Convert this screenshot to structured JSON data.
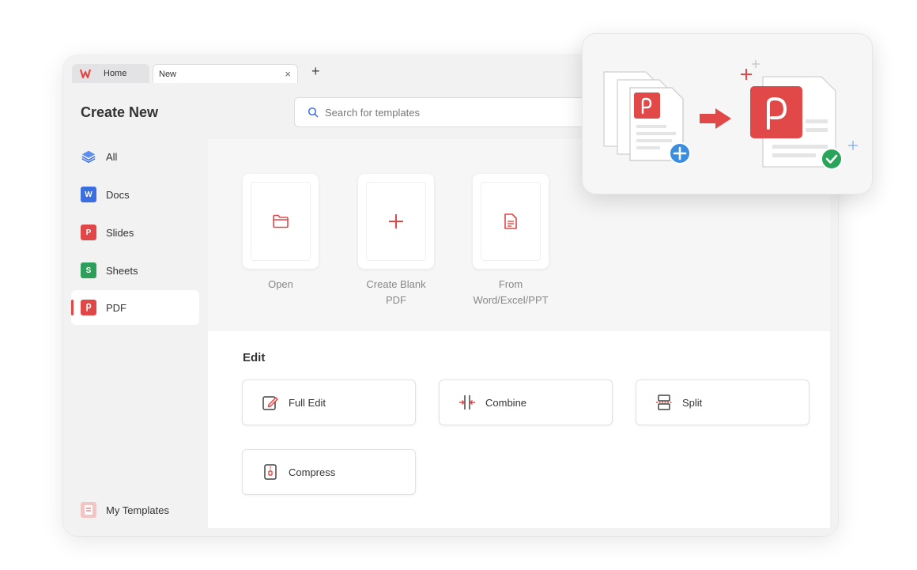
{
  "tabs": {
    "home_label": "Home",
    "new_label": "New",
    "close_glyph": "×",
    "add_glyph": "+"
  },
  "page": {
    "title": "Create New"
  },
  "search": {
    "placeholder": "Search for templates"
  },
  "sidebar": {
    "items": [
      {
        "label": "All",
        "icon": "all-stack-icon"
      },
      {
        "label": "Docs",
        "icon": "docs-icon",
        "badge": "W",
        "color": "#3b6fe0"
      },
      {
        "label": "Slides",
        "icon": "slides-icon",
        "badge": "P",
        "color": "#e04848"
      },
      {
        "label": "Sheets",
        "icon": "sheets-icon",
        "badge": "S",
        "color": "#2e9e5b"
      },
      {
        "label": "PDF",
        "icon": "pdf-icon",
        "color": "#e04848",
        "active": true
      }
    ],
    "my_templates": "My Templates"
  },
  "create": {
    "items": [
      {
        "label": "Open",
        "icon": "folder-icon"
      },
      {
        "label": "Create Blank PDF",
        "icon": "plus-icon"
      },
      {
        "label": "From Word/Excel/PPT",
        "icon": "document-icon"
      }
    ]
  },
  "edit": {
    "title": "Edit",
    "tools": [
      {
        "label": "Full Edit",
        "icon": "edit-icon"
      },
      {
        "label": "Combine",
        "icon": "combine-icon"
      },
      {
        "label": "Split",
        "icon": "split-icon"
      },
      {
        "label": "Compress",
        "icon": "compress-icon"
      }
    ]
  },
  "colors": {
    "accent": "#e04848",
    "blue": "#3b8de0",
    "green": "#28a55a"
  }
}
